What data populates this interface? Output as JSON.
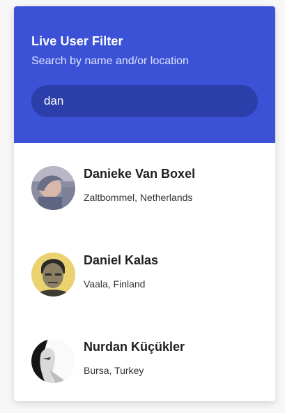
{
  "header": {
    "title": "Live User Filter",
    "subtitle": "Search by name and/or location"
  },
  "search": {
    "value": "dan",
    "placeholder": ""
  },
  "users": [
    {
      "name": "Danieke Van Boxel",
      "location": "Zaltbommel, Netherlands",
      "avatar_icon": "user-photo"
    },
    {
      "name": "Daniel Kalas",
      "location": "Vaala, Finland",
      "avatar_icon": "user-photo"
    },
    {
      "name": "Nurdan Küçükler",
      "location": "Bursa, Turkey",
      "avatar_icon": "user-photo"
    }
  ],
  "colors": {
    "header_bg": "#3b52d6",
    "search_bg": "#2c3ea9",
    "card_bg": "#ffffff"
  }
}
